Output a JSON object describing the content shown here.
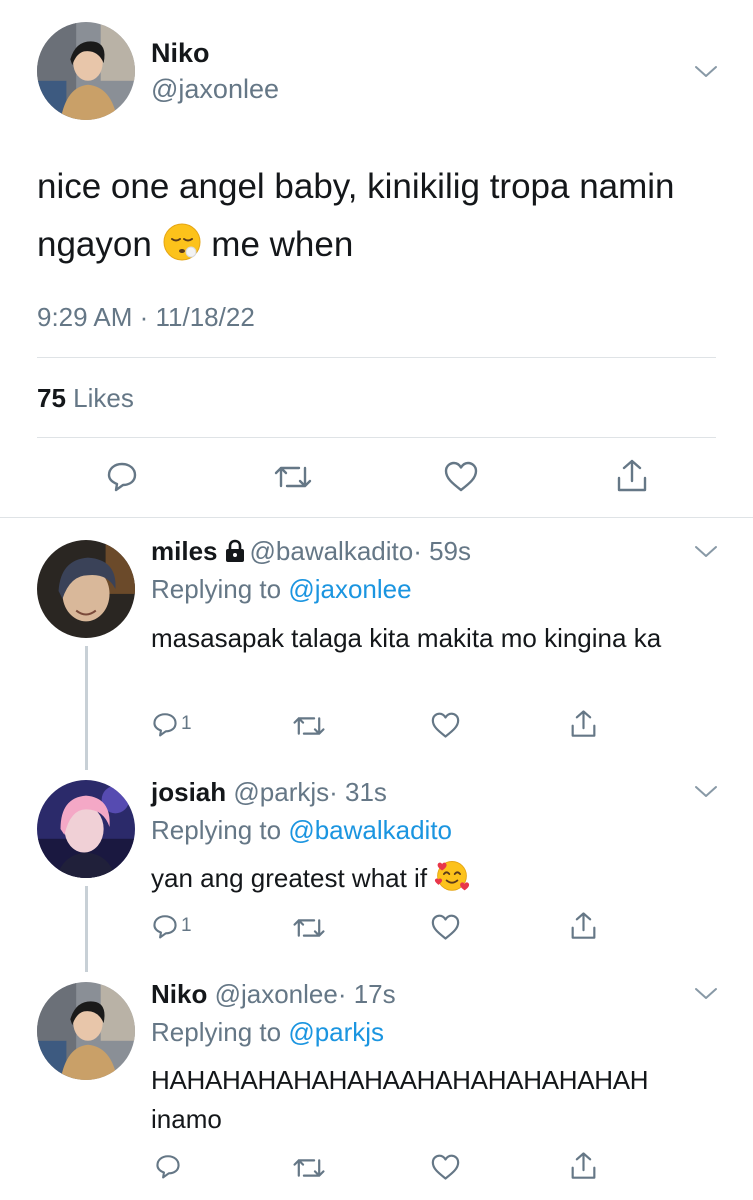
{
  "main_tweet": {
    "name": "Niko",
    "handle": "@jaxonlee",
    "text_part1": "nice one angel baby, kinikilig tropa namin ngayon",
    "text_part2": "me when",
    "emoji": "sighing-face",
    "timestamp": "9:29 AM · 11/18/22",
    "likes_count": "75",
    "likes_label": "Likes"
  },
  "replies": [
    {
      "name": "miles",
      "protected": true,
      "handle": "@bawalkadito",
      "time": "· 59s",
      "replying_prefix": "Replying to",
      "replying_to": "@jaxonlee",
      "text": "masasapak talaga kita makita mo kingina ka",
      "reply_count": "1"
    },
    {
      "name": "josiah",
      "protected": false,
      "handle": "@parkjs",
      "time": "· 31s",
      "replying_prefix": "Replying to",
      "replying_to": "@bawalkadito",
      "text": "yan ang greatest what if",
      "emoji": "smiling-face-with-hearts",
      "reply_count": "1"
    },
    {
      "name": "Niko",
      "protected": false,
      "handle": "@jaxonlee",
      "time": "· 17s",
      "replying_prefix": "Replying to",
      "replying_to": "@parkjs",
      "text_line1": "HAHAHAHAHAHAHAAHAHAHAHAHAHAH",
      "text_line2": "inamo",
      "reply_count": ""
    }
  ],
  "colors": {
    "text": "#14171a",
    "secondary": "#657786",
    "link": "#1b95e0",
    "divider": "#dfe3e6",
    "thread_line": "#c8d0d6"
  }
}
